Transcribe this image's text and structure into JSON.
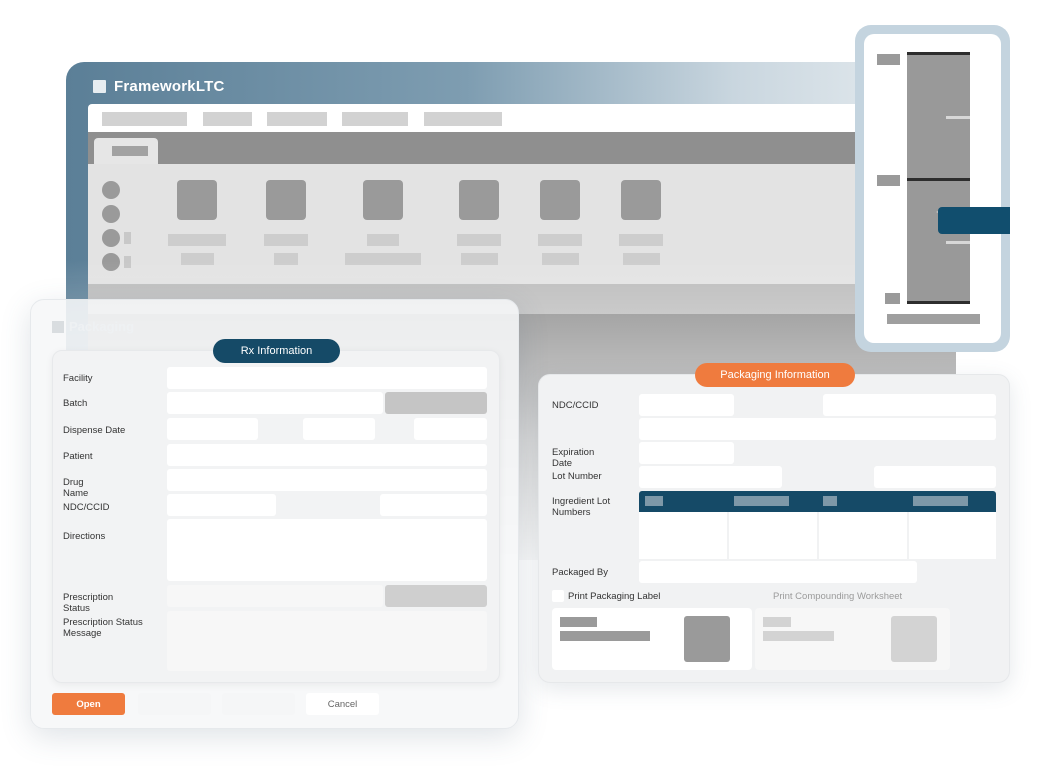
{
  "app": {
    "title": "FrameworkLTC"
  },
  "dialog": {
    "title": "Packaging",
    "rx_section": "Rx Information",
    "fields": {
      "facility": "Facility",
      "batch": "Batch",
      "dispense_date": "Dispense Date",
      "patient": "Patient",
      "drug_name": "Drug\nName",
      "ndc_ccid": "NDC/CCID",
      "directions": "Directions",
      "prescription_status": "Prescription\nStatus",
      "prescription_status_message": "Prescription Status\nMessage"
    },
    "buttons": {
      "open": "Open",
      "cancel": "Cancel"
    }
  },
  "packaging_info": {
    "section": "Packaging Information",
    "fields": {
      "ndc_ccid": "NDC/CCID",
      "expiration_date": "Expiration\nDate",
      "lot_number": "Lot Number",
      "ingredient_lot_numbers": "Ingredient Lot\nNumbers",
      "packaged_by": "Packaged By"
    },
    "print_packaging_label": "Print Packaging Label",
    "print_compounding_worksheet": "Print Compounding Worksheet"
  },
  "colors": {
    "accent_dark": "#154a67",
    "accent_orange": "#ef7b3e"
  }
}
